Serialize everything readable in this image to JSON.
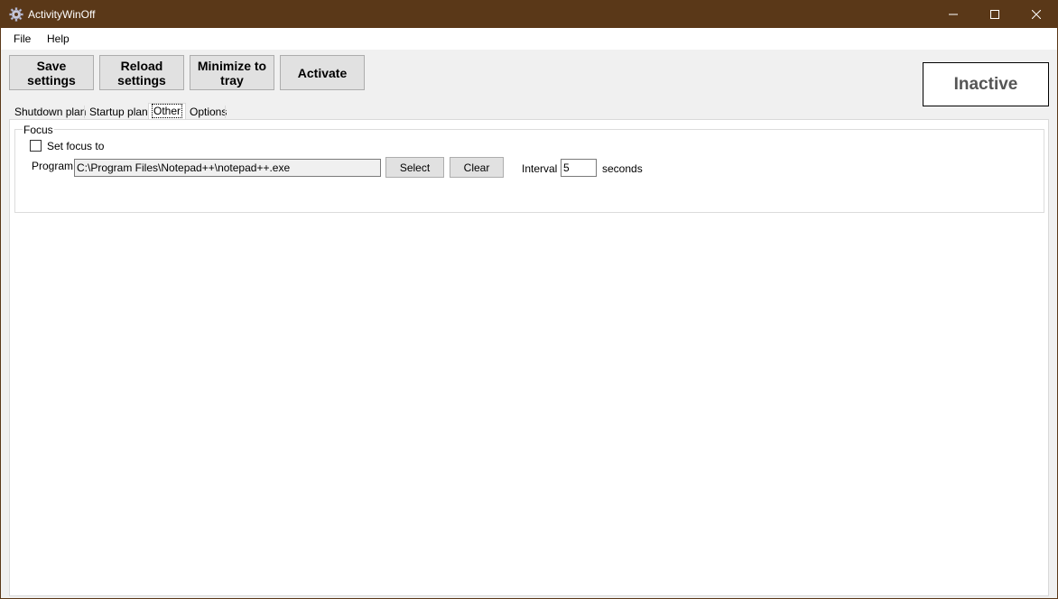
{
  "window": {
    "title": "ActivityWinOff"
  },
  "menu": {
    "file": "File",
    "help": "Help"
  },
  "toolbar": {
    "save": "Save settings",
    "reload": "Reload settings",
    "minimize": "Minimize to tray",
    "activate": "Activate"
  },
  "status": "Inactive",
  "tabs": [
    "Shutdown plan",
    "Startup plan",
    "Other",
    "Options"
  ],
  "active_tab": "Other",
  "focus_group": {
    "title": "Focus",
    "checkbox_label": "Set focus to",
    "checkbox_checked": false,
    "program_label": "Program",
    "program_value": "C:\\Program Files\\Notepad++\\notepad++.exe",
    "select_button": "Select",
    "clear_button": "Clear",
    "interval_label": "Interval",
    "interval_value": "5",
    "seconds_label": "seconds"
  },
  "colors": {
    "titlebar": "#5a3818"
  }
}
